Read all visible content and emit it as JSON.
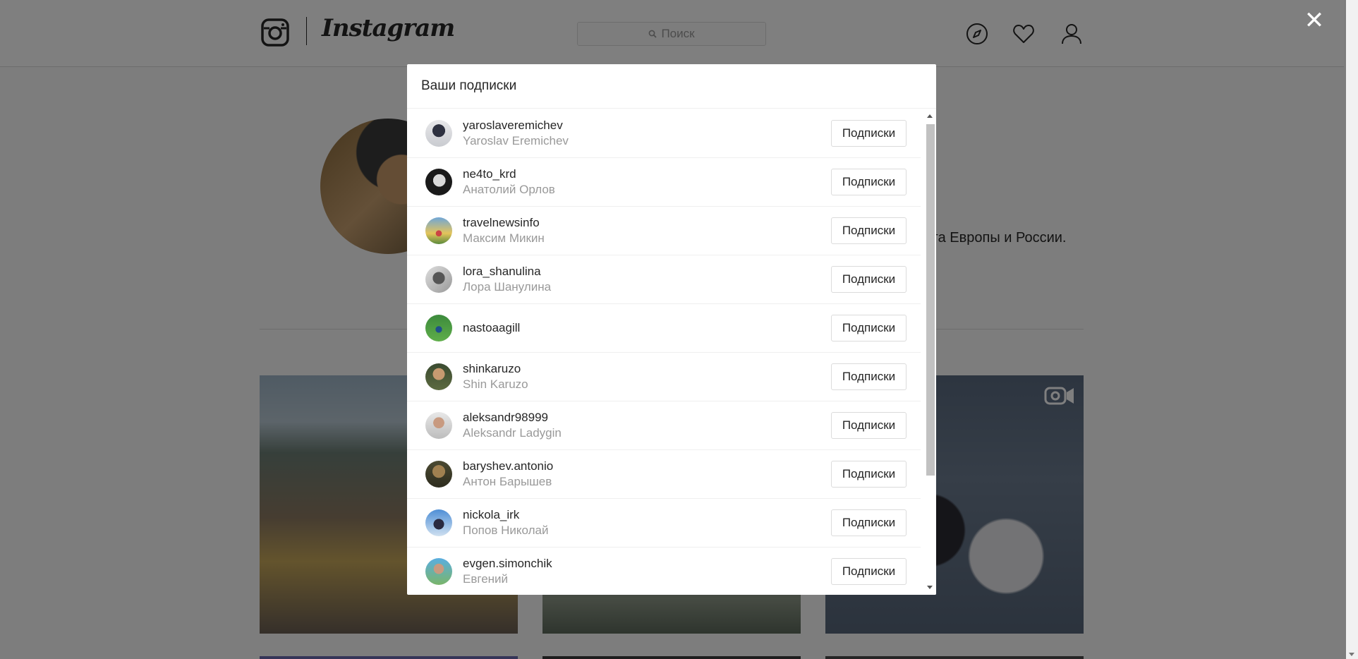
{
  "header": {
    "logo_text": "Instagram",
    "search_placeholder": "Поиск"
  },
  "profile": {
    "bio_fragment": "ата Европы и России."
  },
  "modal": {
    "title": "Ваши подписки",
    "button_label": "Подписки",
    "close_glyph": "✕",
    "rows": [
      {
        "username": "yaroslaveremichev",
        "full_name": "Yaroslav Eremichev"
      },
      {
        "username": "ne4to_krd",
        "full_name": "Анатолий Орлов"
      },
      {
        "username": "travelnewsinfo",
        "full_name": "Максим Микин"
      },
      {
        "username": "lora_shanulina",
        "full_name": "Лора Шанулина"
      },
      {
        "username": "nastoaagill",
        "full_name": ""
      },
      {
        "username": "shinkaruzo",
        "full_name": "Shin Karuzo"
      },
      {
        "username": "aleksandr98999",
        "full_name": "Aleksandr Ladygin"
      },
      {
        "username": "baryshev.antonio",
        "full_name": "Антон Барышев"
      },
      {
        "username": "nickola_irk",
        "full_name": "Попов Николай"
      },
      {
        "username": "evgen.simonchik",
        "full_name": "Евгений"
      }
    ]
  },
  "icons": {
    "logo": "instagram-camera-icon",
    "search": "search-icon",
    "explore": "compass-icon",
    "activity": "heart-icon",
    "profile": "user-icon",
    "close": "close-icon",
    "video": "video-camera-icon"
  },
  "colors": {
    "overlay": "rgba(0,0,0,0.5)",
    "text_primary": "#262626",
    "text_secondary": "#999999",
    "border": "#dbdbdb"
  }
}
